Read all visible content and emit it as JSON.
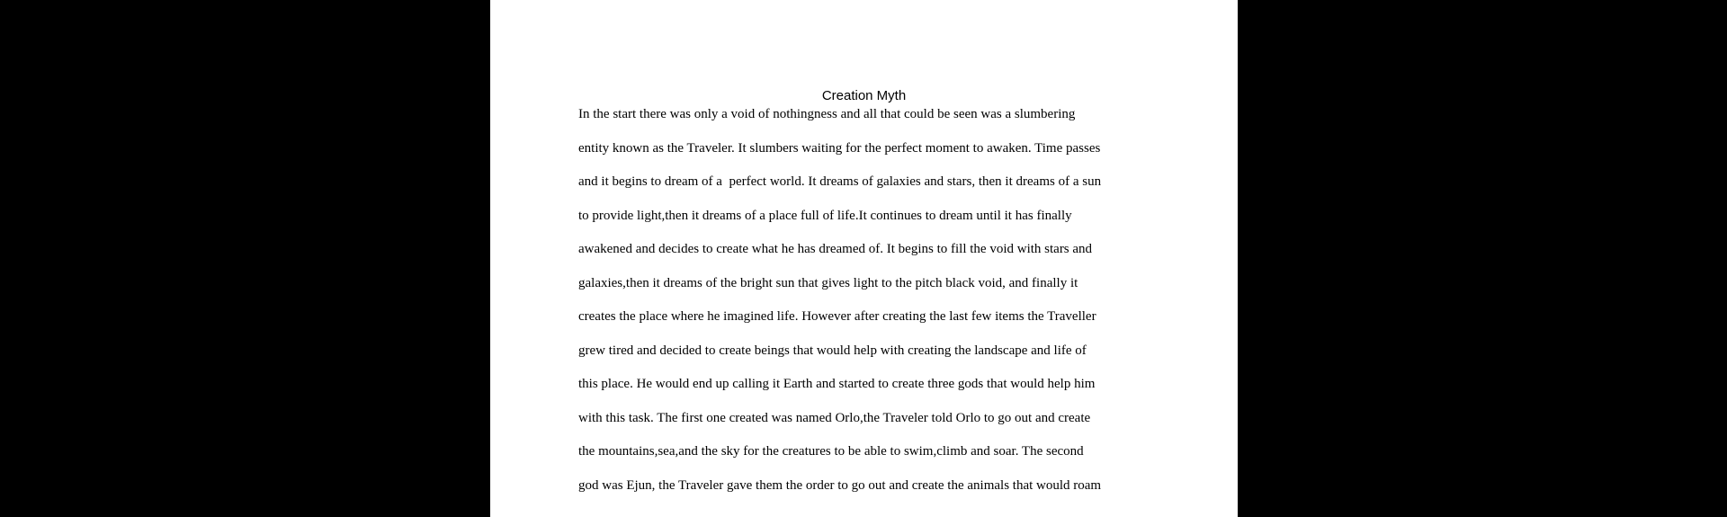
{
  "document": {
    "title": "Creation Myth",
    "lines": [
      "In the start there was only a void of nothingness and all that could be seen was a slumbering",
      "entity known as the Traveler. It slumbers waiting for the perfect moment to awaken. Time passes",
      "and it begins to dream of a  perfect world. It dreams of galaxies and stars, then it dreams of a sun",
      "to provide light,then it dreams of a place full of life.It continues to dream until it has finally",
      "awakened and decides to create what he has dreamed of. It begins to fill the void with stars and",
      "galaxies,then it dreams of the bright sun that gives light to the pitch black void, and finally it",
      "creates the place where he imagined life. However after creating the last few items the Traveller",
      "grew tired and decided to create beings that would help with creating the landscape and life of",
      "this place. He would end up calling it Earth and started to create three gods that would help him",
      "with this task. The first one created was named Orlo,the Traveler told Orlo to go out and create",
      "the mountains,sea,and the sky for the creatures to be able to swim,climb and soar. The second",
      "god was Ejun, the Traveler gave them the order to go out and create the animals that would roam"
    ]
  }
}
